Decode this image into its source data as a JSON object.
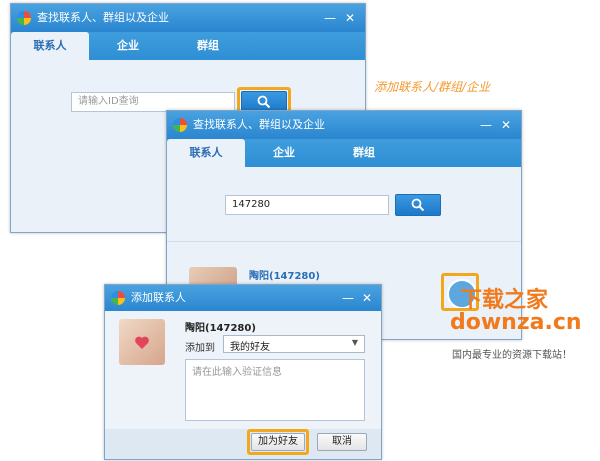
{
  "annotation": "添加联系人/群组/企业",
  "window1": {
    "title": "查找联系人、群组以及企业",
    "tabs": [
      "联系人",
      "企业",
      "群组"
    ],
    "search_placeholder": "请输入ID查询"
  },
  "window2": {
    "title": "查找联系人、群组以及企业",
    "tabs": [
      "联系人",
      "企业",
      "群组"
    ],
    "search_value": "147280",
    "result_name": "陶阳(147280)"
  },
  "dialog": {
    "title": "添加联系人",
    "contact_name": "陶阳(147280)",
    "add_to_label": "添加到",
    "group_value": "我的好友",
    "verify_placeholder": "请在此输入验证信息",
    "add_button": "加为好友",
    "cancel_button": "取消"
  },
  "watermark": {
    "brand": "下载之家",
    "domain": "downza.cn",
    "slogan": "国内最专业的资源下载站！"
  },
  "colors": {
    "titlebar": "#2a86d0",
    "highlight": "#f2a81c",
    "brand_orange": "#f07a1c"
  }
}
